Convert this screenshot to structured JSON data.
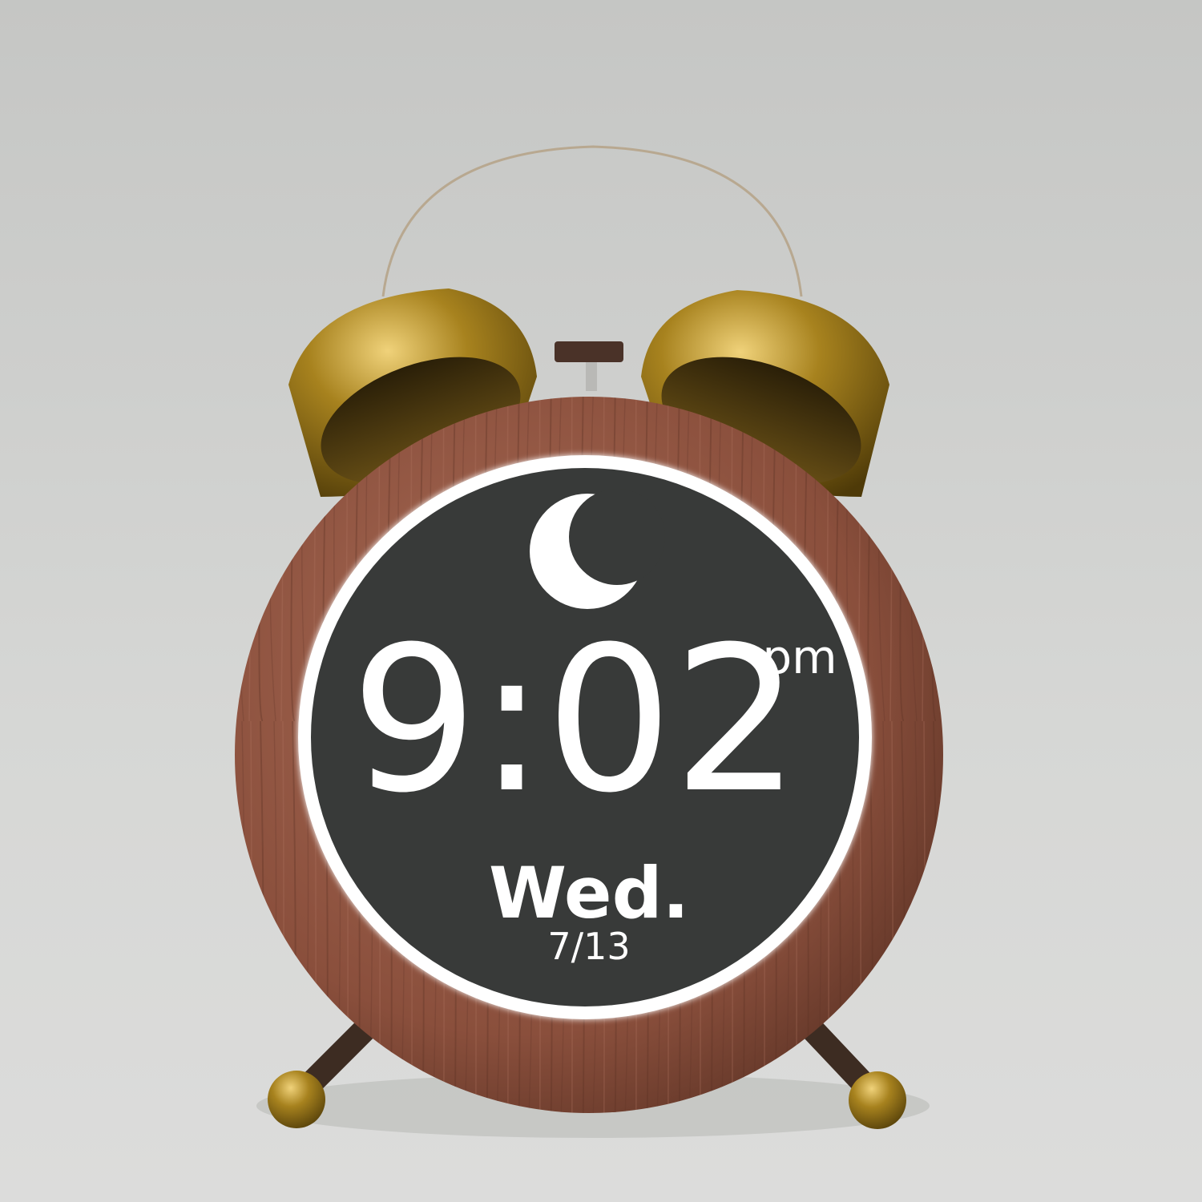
{
  "clock": {
    "icon": "crescent-moon-icon",
    "time": "9:02",
    "meridiem": "pm",
    "day": "Wed.",
    "date": "7/13"
  },
  "colors": {
    "background": "#d0d1cf",
    "wood": "#8a4f3c",
    "screen": "#383a39",
    "glow": "#ffffff",
    "brass": "#8a6a12"
  }
}
